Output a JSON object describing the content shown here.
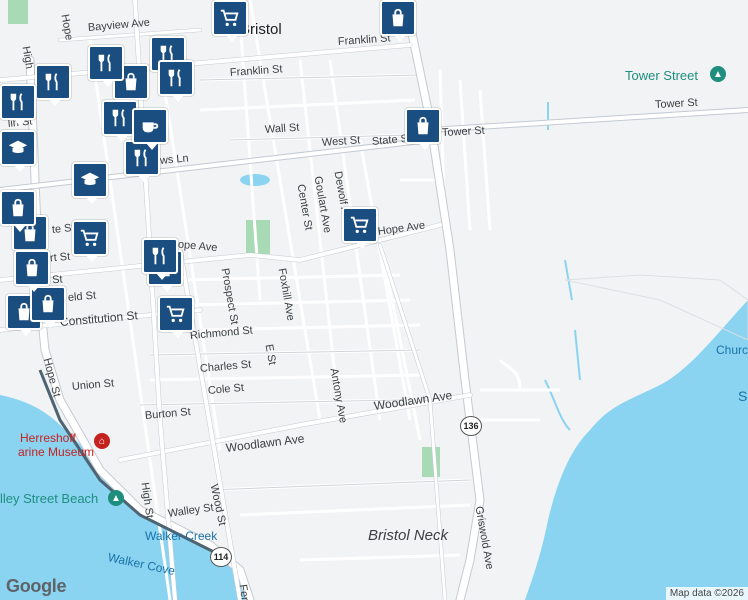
{
  "map": {
    "colors": {
      "land": "#f1f3f4",
      "water": "#8ad4f2",
      "road": "#ffffff",
      "road_edge": "#cfd4da",
      "park": "#a8dab5",
      "marker": "#1a4e80"
    },
    "labels": {
      "bristol": "Bristol",
      "franklin_st_n": "Franklin St",
      "franklin_st_w": "Franklin St",
      "bayview_ave": "Bayview Ave",
      "tower_st": "Tower St",
      "tower_st_w": "Tower St",
      "tower_street_poi": "Tower Street",
      "state_st": "State St",
      "wall_st": "Wall St",
      "west_st": "West St",
      "lin_st": "lin St",
      "ws_ln": "ws Ln",
      "dewolf_ave": "Dewolf Ave",
      "goulart_ave": "Goulart Ave",
      "center_st": "Center St",
      "hope_ave_w": "Hope Ave",
      "hope_ave_e": "Hope Ave",
      "prospect_st": "Prospect St",
      "foxhill_ave": "Foxhill Ave",
      "e_st": "E St",
      "church_st": "rch St",
      "constitution_st": "Constitution St",
      "richmond_st": "Richmond St",
      "charles_st": "Charles St",
      "cole_st": "Cole St",
      "union_st": "Union St",
      "burton_st": "Burton St",
      "antony_ave": "Antony Ave",
      "woodlawn_ave_w": "Woodlawn Ave",
      "woodlawn_ave_e": "Woodlawn Ave",
      "walley_st": "Walley St",
      "wood_st": "Wood St",
      "high_st_s": "High St",
      "high_st_n": "High",
      "hope_st": "Hope St",
      "griswold_ave": "Griswold Ave",
      "bristol_neck": "Bristol Neck",
      "herreshoff_1": "Herreshoff",
      "herreshoff_2": "arine Museum",
      "walley_beach": "lley Street Beach",
      "walker_creek": "Walker Creek",
      "walker_cove": "Walker Cove",
      "church_e": "Churc",
      "s_edge": "S",
      "rt_136": "136",
      "rt_114": "114",
      "fer": "Fer",
      "hope_st_top": "Hope",
      "art_st": "urt St",
      "eld_st": "eld St",
      "te_st": "te St"
    },
    "google_logo": "Google",
    "attribution": "Map data ©2026"
  }
}
